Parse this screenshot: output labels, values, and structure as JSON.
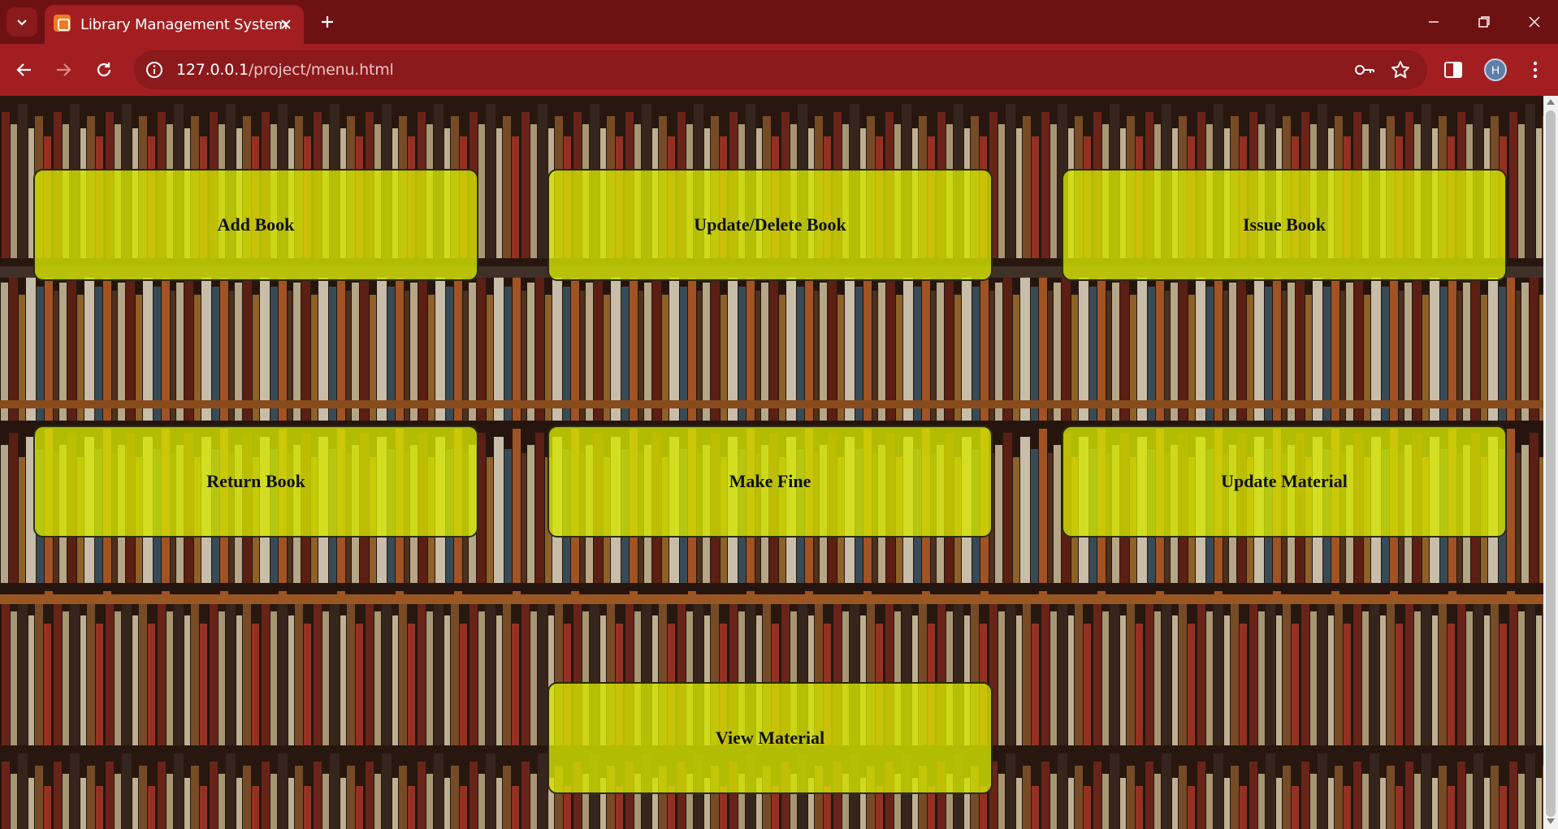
{
  "browser": {
    "tab_title": "Library Management System",
    "url_host": "127.0.0.1",
    "url_path": "/project/menu.html",
    "profile_initial": "H",
    "chrome_color": "#a31e21"
  },
  "menu": {
    "add_book": "Add Book",
    "update_delete_book": "Update/Delete Book",
    "issue_book": "Issue Book",
    "return_book": "Return Book",
    "make_fine": "Make Fine",
    "update_material": "Update Material",
    "view_material": "View Material",
    "button_color": "#d6e600"
  }
}
